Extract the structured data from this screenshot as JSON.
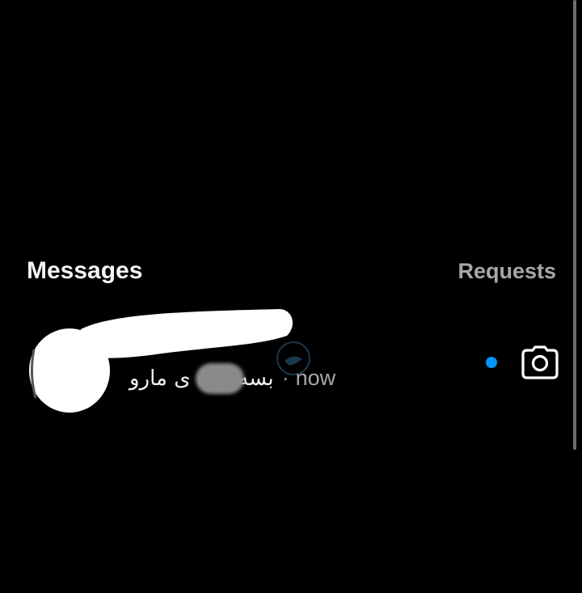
{
  "header": {
    "title": "Messages",
    "requests_label": "Requests"
  },
  "thread": {
    "preview_text": "بسه دیگ   ی مارو",
    "separator": "·",
    "timestamp": "now",
    "unread": true,
    "unread_dot_color": "#0095f6",
    "camera_icon": "camera-icon"
  },
  "colors": {
    "background": "#000000",
    "title": "#f5f5f5",
    "secondary": "#a8a8a8",
    "accent": "#0095f6"
  }
}
